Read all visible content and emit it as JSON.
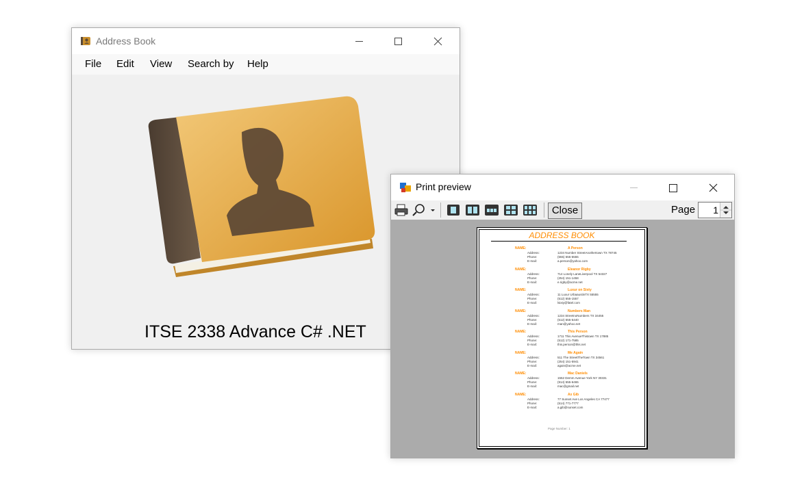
{
  "address_book_window": {
    "title": "Address Book",
    "menu": [
      "File",
      "Edit",
      "View",
      "Search by",
      "Help"
    ],
    "caption": "ITSE 2338 Advance C# .NET"
  },
  "print_preview_window": {
    "title": "Print preview",
    "close_label": "Close",
    "page_label": "Page",
    "page_value": "1",
    "document": {
      "title": "ADDRESS BOOK",
      "name_label": "NAME:",
      "address_label": "Address:",
      "phone_label": "Phone:",
      "email_label": "E-mail:",
      "page_number_text": "Page Number: 1",
      "entries": [
        {
          "name": "A Person",
          "address": "1234 Number StreetAnothertown TX 78745",
          "phone": "(555) 555-5555",
          "email": "a.person@yahoo.com"
        },
        {
          "name": "Eleanor Rigby",
          "address": "714 Lonely LaneLiverpool TX 54327",
          "phone": "(254) 151-1458",
          "email": "e.rigby@acme.net"
        },
        {
          "name": "Luxur on Sixty",
          "address": "11 Luxur UrbaaustinTX 55555",
          "phone": "(512) 555-1557",
          "email": "lsixty@fatel.com"
        },
        {
          "name": "Numbers Man",
          "address": "1234 StreetnoNumbers TX 34455",
          "phone": "(512) 555-5440",
          "email": "man@yahoo.net"
        },
        {
          "name": "This Person",
          "address": "1711 This AvenueThistown TX 17885",
          "phone": "(512) 171-7585",
          "email": "this.person@this.net"
        },
        {
          "name": "Me Again",
          "address": "511 The StreetTheTown TX 34561",
          "phone": "(254) 151-5941",
          "email": "again@acme.net"
        },
        {
          "name": "Mac Daniels",
          "address": "1552 Demm Avenue York NY 30331",
          "phone": "(914) 555-6465",
          "email": "mac@gmail.net"
        },
        {
          "name": "Ax Gib",
          "address": "77 Sunset Ave Los Angeles CA 77477",
          "phone": "(514) 771-7777",
          "email": "a.gib@sunset.com"
        }
      ]
    }
  }
}
